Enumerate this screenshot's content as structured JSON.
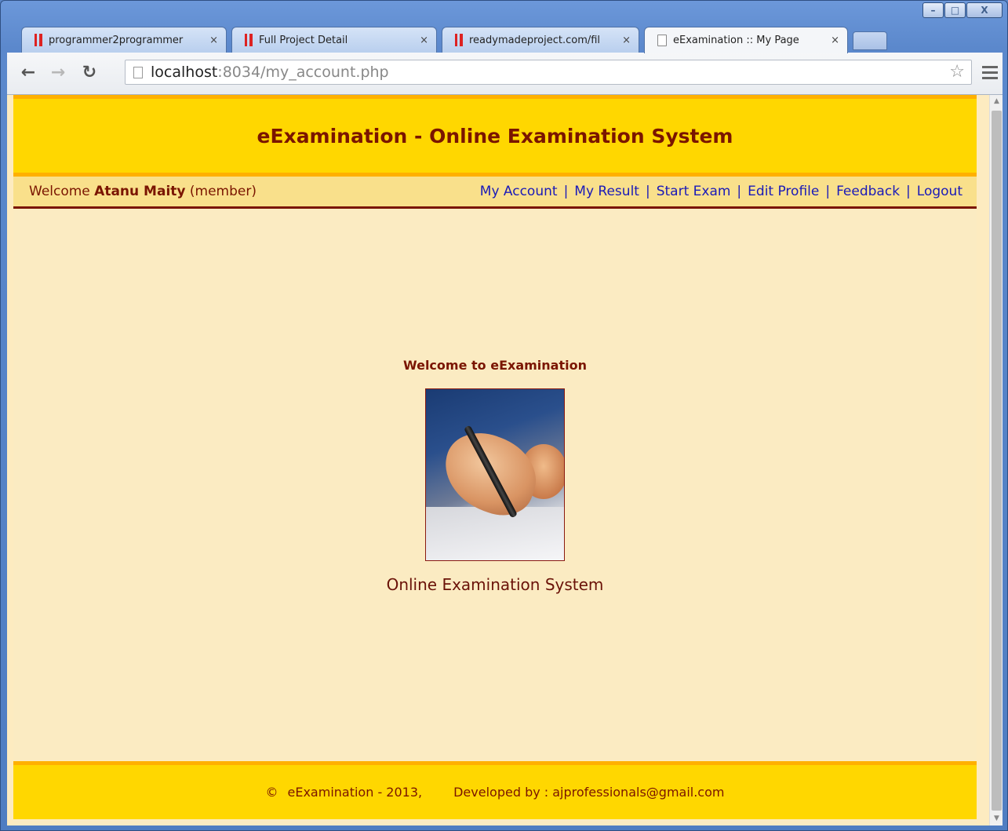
{
  "browser": {
    "tabs": [
      {
        "title": "programmer2programmer",
        "favicon": "red-bars-icon",
        "active": false
      },
      {
        "title": "Full Project Detail",
        "favicon": "red-bars-icon",
        "active": false
      },
      {
        "title": "readymadeproject.com/fil",
        "favicon": "red-bars-icon",
        "active": false
      },
      {
        "title": "eExamination :: My Page",
        "favicon": "page-icon",
        "active": true
      }
    ],
    "tab_close_glyph": "×",
    "url_host": "localhost",
    "url_path": ":8034/my_account.php",
    "window_controls": {
      "minimize": "–",
      "maximize": "□",
      "close": "X"
    }
  },
  "site": {
    "title": "eExamination - Online Examination System",
    "welcome_prefix": "Welcome",
    "user_name": "Atanu Maity",
    "user_role": "(member)",
    "nav": [
      {
        "label": "My Account"
      },
      {
        "label": "My Result"
      },
      {
        "label": "Start Exam"
      },
      {
        "label": "Edit Profile"
      },
      {
        "label": "Feedback"
      },
      {
        "label": "Logout"
      }
    ],
    "nav_separator": "|"
  },
  "main": {
    "heading": "Welcome to eExamination",
    "caption": "Online Examination System"
  },
  "footer": {
    "copyright_symbol": "©",
    "copyright": "eExamination - 2013,",
    "developed_by": "Developed by : ajprofessionals@gmail.com"
  },
  "colors": {
    "header_bg": "#ffd700",
    "header_border": "#ffb000",
    "brand_text": "#7a1500",
    "page_bg": "#fbebc2",
    "link": "#1a1ab8"
  }
}
